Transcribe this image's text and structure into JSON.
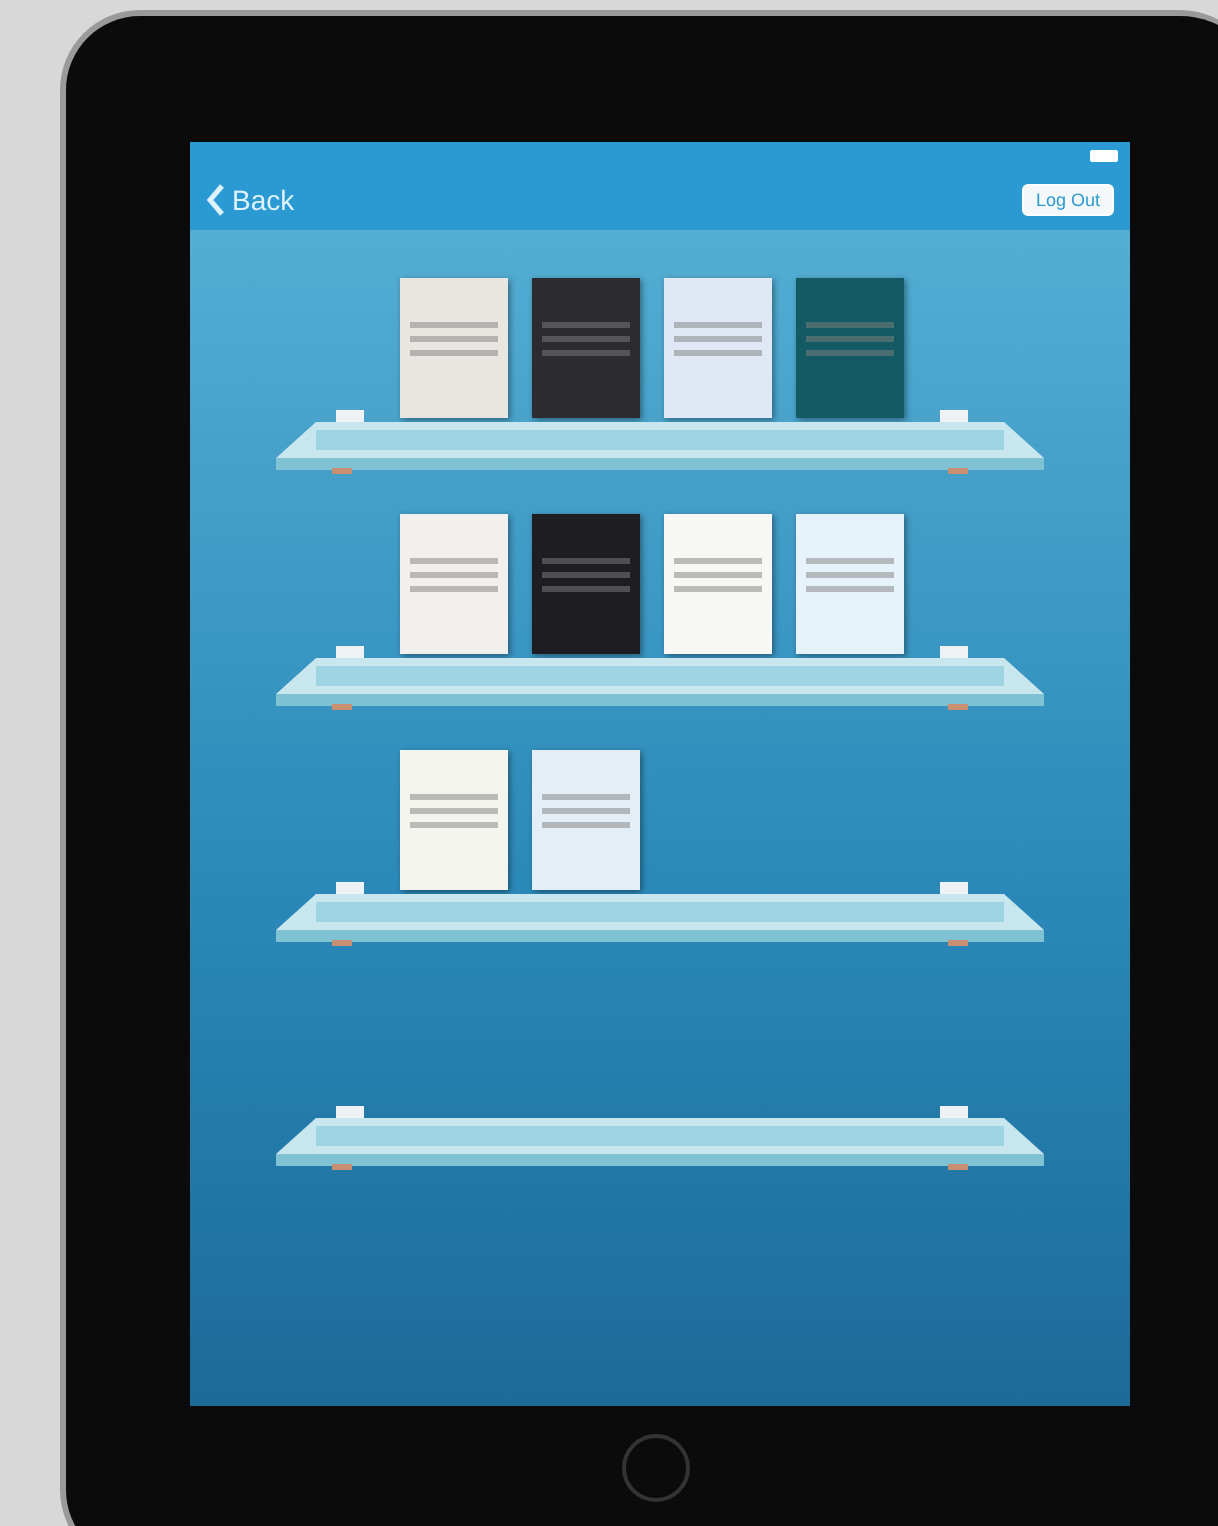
{
  "nav_bar": {
    "back_label": "Back",
    "logout_label": "Log Out"
  },
  "shelves": [
    {
      "kind": "stocked",
      "books": [
        {
          "color": "#e8e6e0"
        },
        {
          "color": "#2b2b30"
        },
        {
          "color": "#dfe8f4"
        },
        {
          "color": "#145a64"
        }
      ]
    },
    {
      "kind": "stocked",
      "books": [
        {
          "color": "#f2f0ee"
        },
        {
          "color": "#1e1e22"
        },
        {
          "color": "#f7f7f5"
        },
        {
          "color": "#e6f2fa"
        }
      ]
    },
    {
      "kind": "stocked",
      "books": [
        {
          "color": "#f4f4ee"
        },
        {
          "color": "#e4eef6"
        }
      ]
    },
    {
      "kind": "empty"
    }
  ]
}
